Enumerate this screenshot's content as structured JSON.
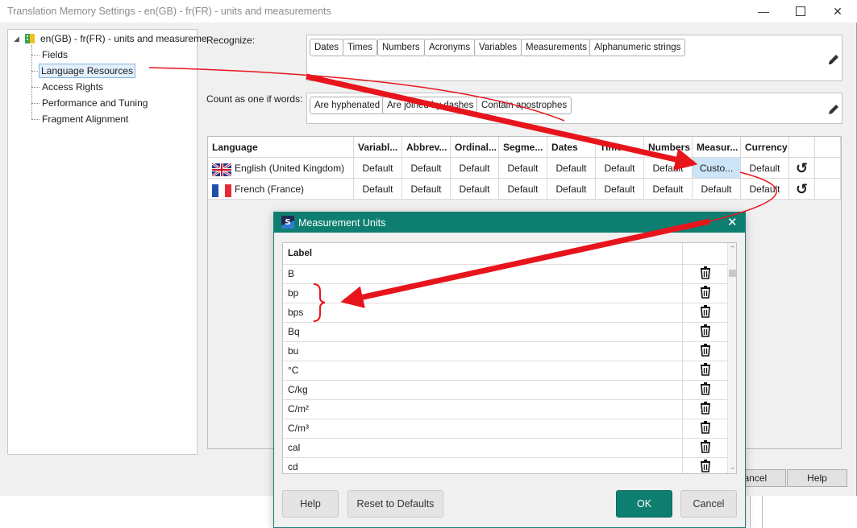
{
  "window": {
    "title": "Translation Memory Settings - en(GB) - fr(FR) - units and measurements"
  },
  "tree": {
    "root": "en(GB) - fr(FR) - units and measureme",
    "items": [
      "Fields",
      "Language Resources",
      "Access Rights",
      "Performance and Tuning",
      "Fragment Alignment"
    ],
    "selected": "Language Resources"
  },
  "recognize": {
    "label": "Recognize:",
    "chips": [
      "Dates",
      "Times",
      "Numbers",
      "Acronyms",
      "Variables",
      "Measurements",
      "Alphanumeric strings"
    ]
  },
  "count_as_one": {
    "label": "Count as one if words:",
    "chips": [
      "Are hyphenated",
      "Are joined by dashes",
      "Contain apostrophes"
    ]
  },
  "grid": {
    "columns": [
      "Language",
      "Variabl...",
      "Abbrev...",
      "Ordinal...",
      "Segme...",
      "Dates",
      "Times",
      "Numbers",
      "Measur...",
      "Currency"
    ],
    "rows": [
      {
        "language": "English (United Kingdom)",
        "flag": "uk-flag",
        "cells": [
          "Default",
          "Default",
          "Default",
          "Default",
          "Default",
          "Default",
          "Default",
          "Custo...",
          "Default"
        ]
      },
      {
        "language": "French (France)",
        "flag": "france-flag",
        "cells": [
          "Default",
          "Default",
          "Default",
          "Default",
          "Default",
          "Default",
          "Default",
          "Default",
          "Default"
        ]
      }
    ]
  },
  "main_buttons": {
    "cancel": "Cancel",
    "help": "Help"
  },
  "dialog": {
    "title": "Measurement Units",
    "column_label": "Label",
    "units": [
      "B",
      "bp",
      "bps",
      "Bq",
      "bu",
      "°C",
      "C/kg",
      "C/m²",
      "C/m³",
      "cal",
      "cd"
    ],
    "buttons": {
      "help": "Help",
      "reset": "Reset to Defaults",
      "ok": "OK",
      "cancel": "Cancel"
    }
  },
  "colors": {
    "accent": "#0e7e70",
    "arrow": "#e8141c",
    "selection": "#cce4f7"
  }
}
